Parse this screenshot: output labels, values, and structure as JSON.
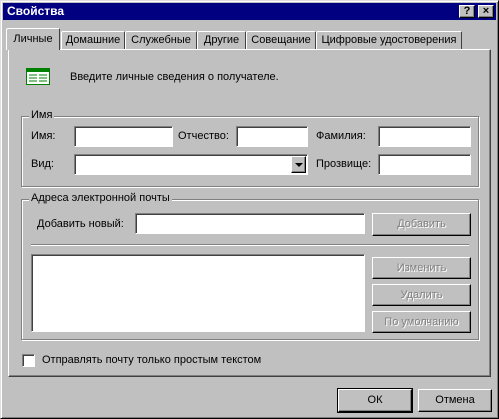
{
  "window": {
    "title": "Свойства",
    "help_label": "?",
    "close_label": "×"
  },
  "tabs": [
    {
      "label": "Личные",
      "active": true
    },
    {
      "label": "Домашние",
      "active": false
    },
    {
      "label": "Служебные",
      "active": false
    },
    {
      "label": "Другие",
      "active": false
    },
    {
      "label": "Совещание",
      "active": false
    },
    {
      "label": "Цифровые удостоверения",
      "active": false
    }
  ],
  "intro": {
    "text": "Введите личные сведения о получателе.",
    "icon": "contact-card-icon"
  },
  "name_group": {
    "title": "Имя",
    "first_name_label": "Имя:",
    "first_name_value": "",
    "middle_name_label": "Отчество:",
    "middle_name_value": "",
    "last_name_label": "Фамилия:",
    "last_name_value": "",
    "display_label": "Вид:",
    "display_value": "",
    "nickname_label": "Прозвище:",
    "nickname_value": ""
  },
  "email_group": {
    "title": "Адреса электронной почты",
    "add_new_label": "Добавить новый:",
    "add_new_value": "",
    "add_button": "Добавить",
    "edit_button": "Изменить",
    "delete_button": "Удалить",
    "default_button": "По умолчанию",
    "addresses": []
  },
  "plain_text": {
    "label": "Отправлять почту только простым текстом",
    "checked": false
  },
  "footer": {
    "ok_label": "ОК",
    "cancel_label": "Отмена"
  }
}
